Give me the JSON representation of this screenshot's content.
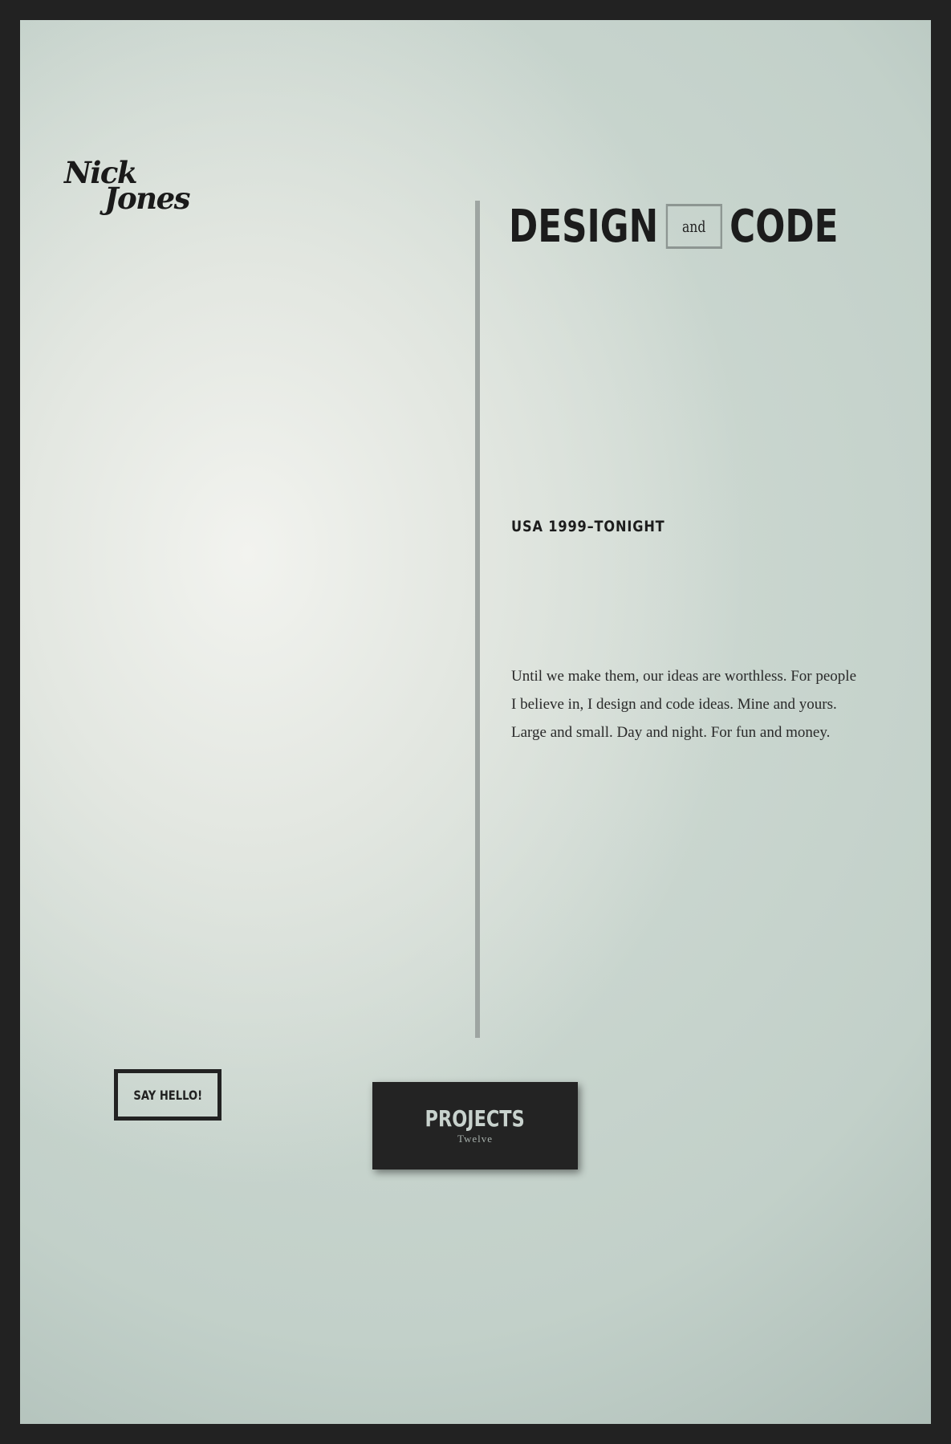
{
  "colors": {
    "frame_border": "#222222",
    "background_light": "#f2f3ef",
    "background_edge": "#9fb0aa",
    "text_dark": "#1c1c1c",
    "divider": "#9ea5a2",
    "button_dark": "#232323"
  },
  "logo": {
    "line1": "Nick",
    "line2": "Jones"
  },
  "headline": {
    "word1": "DESIGN",
    "connector": "and",
    "word2": "CODE"
  },
  "tagline": "USA 1999–TONIGHT",
  "intro": {
    "line1": "Until we make them, our ideas are worthless. For people",
    "line2": "I believe in, I design and code ideas. Mine and yours.",
    "line3": "Large and small. Day and night. For fun and money."
  },
  "buttons": {
    "say_hello": "SAY HELLO!",
    "projects_title": "PROJECTS",
    "projects_count": "Twelve"
  }
}
